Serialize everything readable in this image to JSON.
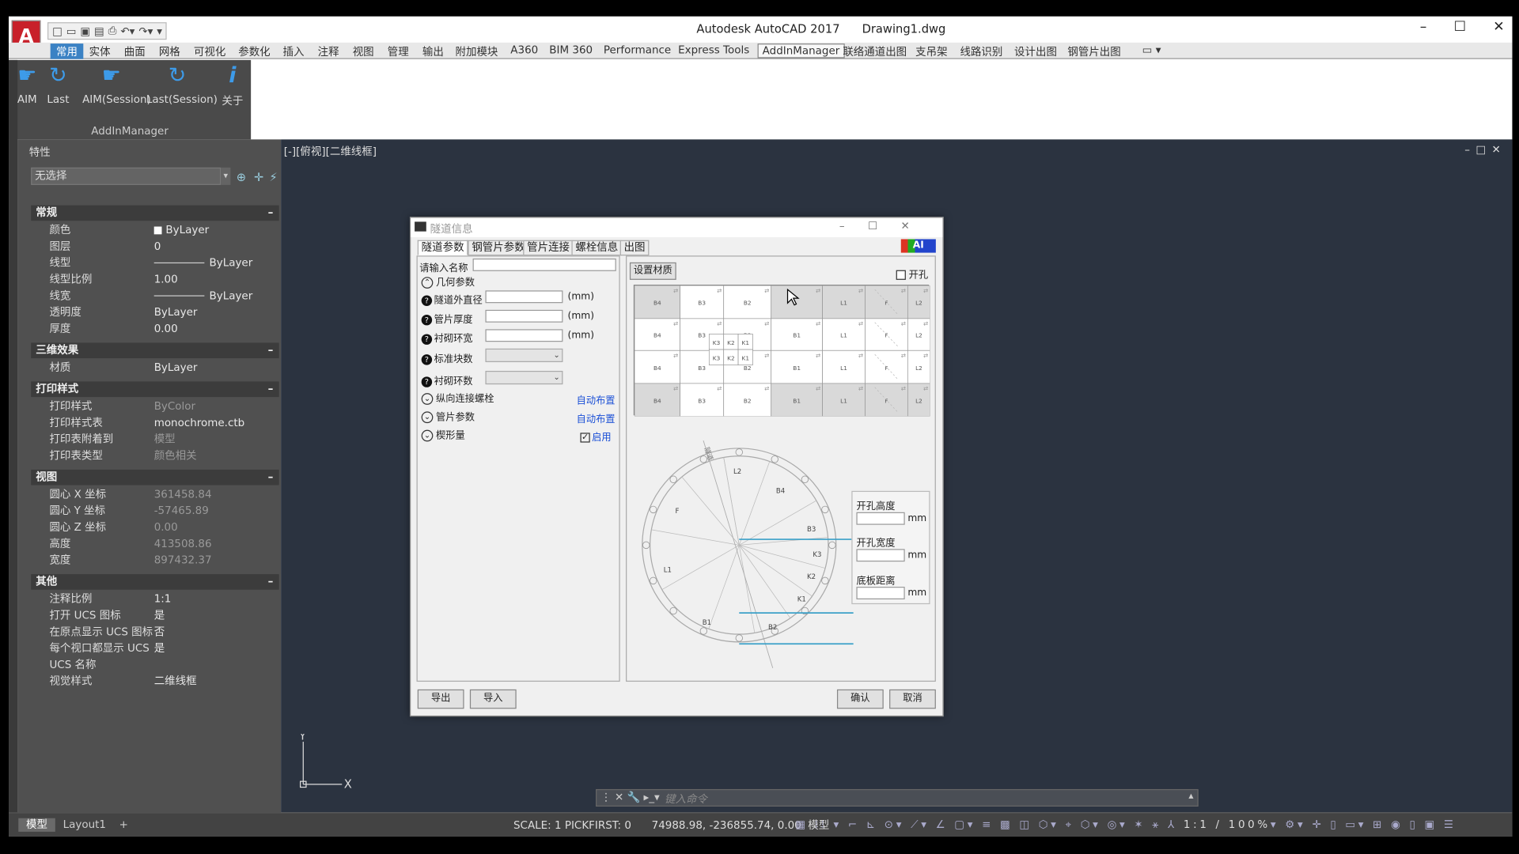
{
  "app": {
    "title": "Autodesk AutoCAD 2017",
    "file": "Drawing1.dwg",
    "logo": "A"
  },
  "ribbon_tabs": [
    "常用",
    "实体",
    "曲面",
    "网格",
    "可视化",
    "参数化",
    "插入",
    "注释",
    "视图",
    "管理",
    "输出",
    "附加模块",
    "A360",
    "BIM 360",
    "Performance",
    "Express Tools",
    "AddInManager",
    "联络通道出图",
    "支吊架",
    "线路识别",
    "设计出图",
    "钢管片出图"
  ],
  "ribbon": {
    "buttons": [
      {
        "icon": "hand-run-icon",
        "label": "AIM"
      },
      {
        "icon": "refresh-icon",
        "label": "Last"
      },
      {
        "icon": "hand-run-icon",
        "label": "AIM(Session)"
      },
      {
        "icon": "refresh-icon",
        "label": "Last(Session)"
      },
      {
        "icon": "info-icon",
        "label": "关于"
      }
    ],
    "group": "AddInManager"
  },
  "props": {
    "title": "特性",
    "selection": "无选择",
    "sections": [
      {
        "name": "常规",
        "rows": [
          [
            "颜色",
            "ByLayer"
          ],
          [
            "图层",
            "0"
          ],
          [
            "线型",
            "ByLayer"
          ],
          [
            "线型比例",
            "1.00"
          ],
          [
            "线宽",
            "ByLayer"
          ],
          [
            "透明度",
            "ByLayer"
          ],
          [
            "厚度",
            "0.00"
          ]
        ]
      },
      {
        "name": "三维效果",
        "rows": [
          [
            "材质",
            "ByLayer"
          ]
        ]
      },
      {
        "name": "打印样式",
        "rows": [
          [
            "打印样式",
            "ByColor"
          ],
          [
            "打印样式表",
            "monochrome.ctb"
          ],
          [
            "打印表附着到",
            "模型"
          ],
          [
            "打印表类型",
            "颜色相关"
          ]
        ]
      },
      {
        "name": "视图",
        "rows": [
          [
            "圆心 X 坐标",
            "361458.84"
          ],
          [
            "圆心 Y 坐标",
            "-57465.89"
          ],
          [
            "圆心 Z 坐标",
            "0.00"
          ],
          [
            "高度",
            "413508.86"
          ],
          [
            "宽度",
            "897432.37"
          ]
        ]
      },
      {
        "name": "其他",
        "rows": [
          [
            "注释比例",
            "1:1"
          ],
          [
            "打开 UCS 图标",
            "是"
          ],
          [
            "在原点显示 UCS 图标",
            "否"
          ],
          [
            "每个视口都显示 UCS",
            "是"
          ],
          [
            "UCS 名称",
            ""
          ],
          [
            "视觉样式",
            "二维线框"
          ]
        ]
      }
    ],
    "toggle": "–"
  },
  "viewport": {
    "label": "[-][俯视][二维线框]",
    "ucs_x": "X",
    "ucs_y": "Y"
  },
  "command": {
    "placeholder": "键入命令"
  },
  "layout_tabs": [
    "模型",
    "Layout1",
    "+"
  ],
  "status": {
    "scale": "SCALE: 1  PICKFIRST: 0",
    "coords": "74988.98, -236855.74, 0.00",
    "mode": "模型",
    "zoom": "1:1 / 100%"
  },
  "dialog": {
    "title": "隧道信息",
    "tabs": [
      "隧道参数",
      "钢管片参数",
      "管片连接",
      "螺栓信息",
      "出图"
    ],
    "ai": "AI",
    "name_label": "请输入名称",
    "geom": "几何参数",
    "fields": [
      {
        "label": "隧道外直径",
        "unit": "(mm)"
      },
      {
        "label": "管片厚度",
        "unit": "(mm)"
      },
      {
        "label": "衬砌环宽",
        "unit": "(mm)"
      }
    ],
    "std_blocks": "标准块数",
    "ring_count": "衬砌环数",
    "bolts": "纵向连接螺栓",
    "auto1": "自动布置",
    "segs": "管片参数",
    "auto2": "自动布置",
    "wedge": "楔形量",
    "enable": "启用",
    "set_material": "设置材质",
    "open_hole": "开孔",
    "grid_rows": [
      [
        "B4",
        "B3",
        "B2",
        "",
        "L1",
        "F",
        "L2"
      ],
      [
        "B4",
        "B3",
        "B2",
        "B1",
        "L1",
        "F",
        "L2"
      ],
      [
        "B4",
        "B3",
        "B2",
        "B1",
        "L1",
        "F",
        "L2"
      ],
      [
        "B4",
        "B3",
        "B2",
        "B1",
        "L1",
        "F",
        "L2"
      ]
    ],
    "k_cells": [
      "K3",
      "K2",
      "K1"
    ],
    "ring_labels": [
      "L2",
      "B4",
      "F",
      "B3",
      "K3",
      "L1",
      "K2",
      "K1",
      "B1",
      "B2"
    ],
    "ring_tag": "隧道",
    "hole": {
      "height": "开孔高度",
      "width": "开孔宽度",
      "bottom": "底板距离",
      "unit": "mm"
    },
    "export": "导出",
    "import": "导入",
    "ok": "确认",
    "cancel": "取消"
  }
}
